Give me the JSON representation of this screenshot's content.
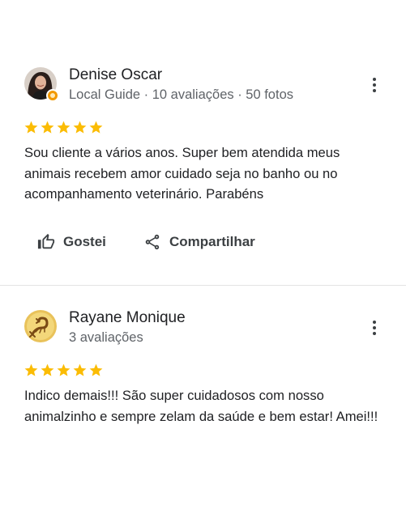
{
  "reviews": [
    {
      "name": "Denise Oscar",
      "meta": "Local Guide · 10 avaliações · 50 fotos",
      "rating": 5,
      "text": "Sou cliente a vários anos. Super bem atendida meus animais recebem amor cuidado seja no banho ou no acompanhamento veterinário.  Parabéns",
      "avatar_icon": "profile-photo",
      "like_label": "Gostei",
      "share_label": "Compartilhar"
    },
    {
      "name": "Rayane Monique",
      "meta": "3 avaliações",
      "rating": 5,
      "text": "Indico demais!!! São super cuidadosos com nosso animalzinho e sempre zelam da saúde e bem estar! Amei!!!",
      "avatar_icon": "scorpion-avatar"
    }
  ],
  "colors": {
    "star": "#fbbc04",
    "text": "#202124",
    "secondary": "#5f6368",
    "guide_badge": "#f29900"
  }
}
